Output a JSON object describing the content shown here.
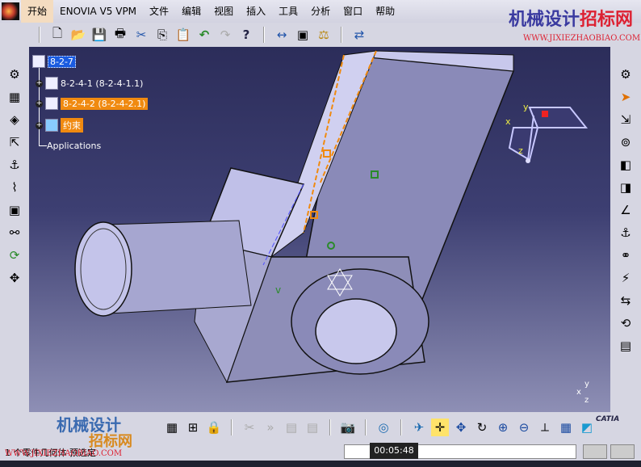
{
  "menubar": {
    "items": [
      "开始",
      "ENOVIA V5 VPM",
      "文件",
      "编辑",
      "视图",
      "插入",
      "工具",
      "分析",
      "窗口",
      "帮助"
    ]
  },
  "toolbar": {
    "icons": [
      "new-icon",
      "open-icon",
      "save-icon",
      "print-icon",
      "cut-icon",
      "copy-icon",
      "paste-icon",
      "undo-icon",
      "redo-icon",
      "whats-this-icon",
      "measure-icon",
      "inertia-icon",
      "weight-icon",
      "catalog-icon"
    ],
    "glyphs": [
      "🗋",
      "📂",
      "💾",
      "🖶",
      "✂",
      "⎘",
      "📋",
      "↶",
      "↷",
      "?",
      "↔",
      "▣",
      "⚖",
      "⇄"
    ]
  },
  "tree": {
    "root": "8-2-7",
    "children": [
      {
        "label": "8-2-4-1 (8-2-4-1.1)",
        "state": "normal"
      },
      {
        "label": "8-2-4-2 (8-2-4-2.1)",
        "state": "highlighted"
      },
      {
        "label": "约束",
        "state": "highlighted"
      }
    ],
    "applications": "Applications"
  },
  "compass": {
    "x": "x",
    "y": "y",
    "z": "z"
  },
  "axis": {
    "x": "x",
    "y": "y",
    "z": "z"
  },
  "status": {
    "message": "1 个零件几何体 预选定",
    "timer": "00:05:48",
    "command_input": ""
  },
  "watermark": {
    "title_blue": "机械设计",
    "title_red": "招标网",
    "url": "WWW.JIXIEZHAOBIAO.COM",
    "bottom_blue": "机械设计",
    "bottom_orange": "招标网",
    "bottom_url": "WWW.JIXIEZHAOBIAO.COM"
  },
  "brand": {
    "catia": "CATIA"
  },
  "colors": {
    "highlight": "#f08a10",
    "selection": "#1a5be0",
    "part": "#b4b4dc"
  }
}
